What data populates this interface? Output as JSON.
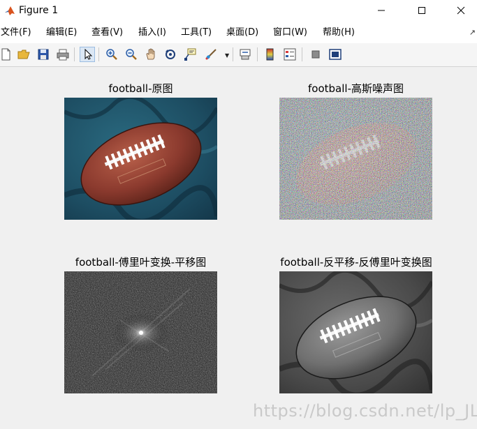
{
  "window": {
    "title": "Figure 1",
    "controls": {
      "minimize": "minimize-icon",
      "maximize": "maximize-icon",
      "close": "close-icon"
    }
  },
  "menubar": {
    "items": [
      {
        "label": "文件(F)"
      },
      {
        "label": "编辑(E)"
      },
      {
        "label": "查看(V)"
      },
      {
        "label": "插入(I)"
      },
      {
        "label": "工具(T)"
      },
      {
        "label": "桌面(D)"
      },
      {
        "label": "窗口(W)"
      },
      {
        "label": "帮助(H)"
      }
    ]
  },
  "toolbar": {
    "tools": [
      "new-figure-icon",
      "open-file-icon",
      "save-icon",
      "print-icon",
      "pointer-icon",
      "zoom-in-icon",
      "zoom-out-icon",
      "pan-hand-icon",
      "rotate-3d-icon",
      "data-cursor-icon",
      "brush-icon",
      "link-plot-icon",
      "colorbar-icon",
      "legend-icon",
      "hide-plot-tools-icon",
      "show-plot-tools-icon"
    ]
  },
  "axes": [
    {
      "title": "football-原图",
      "kind": "original"
    },
    {
      "title": "football-高斯噪声图",
      "kind": "noisy"
    },
    {
      "title": "football-傅里叶变换-平移图",
      "kind": "spectrum"
    },
    {
      "title": "football-反平移-反傅里叶变换图",
      "kind": "grayscale"
    }
  ],
  "watermark": "https://blog.csdn.net/lp_JL",
  "colors": {
    "background": "#f0f0f0",
    "cloth": "#1f4e63",
    "football": "#8b3a2e",
    "laces": "#ffffff"
  }
}
